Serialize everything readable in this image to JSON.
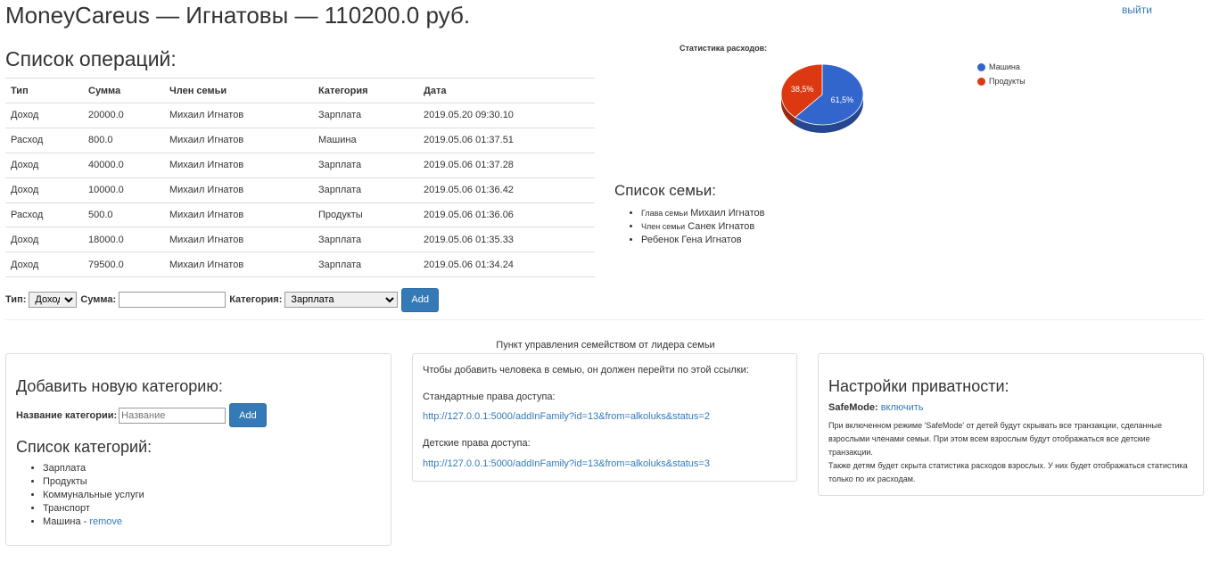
{
  "header": {
    "title": "MoneyCareus — Игнатовы — 110200.0 руб.",
    "logout_label": "выйти"
  },
  "operations": {
    "heading": "Список операций:",
    "columns": [
      "Тип",
      "Сумма",
      "Член семьи",
      "Категория",
      "Дата"
    ],
    "rows": [
      [
        "Доход",
        "20000.0",
        "Михаил Игнатов",
        "Зарплата",
        "2019.05.20 09:30.10"
      ],
      [
        "Расход",
        "800.0",
        "Михаил Игнатов",
        "Машина",
        "2019.05.06 01:37.51"
      ],
      [
        "Доход",
        "40000.0",
        "Михаил Игнатов",
        "Зарплата",
        "2019.05.06 01:37.28"
      ],
      [
        "Доход",
        "10000.0",
        "Михаил Игнатов",
        "Зарплата",
        "2019.05.06 01:36.42"
      ],
      [
        "Расход",
        "500.0",
        "Михаил Игнатов",
        "Продукты",
        "2019.05.06 01:36.06"
      ],
      [
        "Доход",
        "18000.0",
        "Михаил Игнатов",
        "Зарплата",
        "2019.05.06 01:35.33"
      ],
      [
        "Доход",
        "79500.0",
        "Михаил Игнатов",
        "Зарплата",
        "2019.05.06 01:34.24"
      ]
    ]
  },
  "add_operation": {
    "type_label": "Тип:",
    "type_value": "Доход",
    "sum_label": "Сумма:",
    "sum_value": "",
    "category_label": "Категория:",
    "category_value": "Зарплата",
    "submit_label": "Add"
  },
  "chart_data": {
    "type": "pie",
    "title": "Статистика расходов:",
    "categories": [
      "Машина",
      "Продукты"
    ],
    "values": [
      61.5,
      38.5
    ],
    "labels": [
      "61,5%",
      "38,5%"
    ],
    "colors": [
      "#3366cc",
      "#dc3912"
    ],
    "legend_position": "right"
  },
  "family": {
    "heading": "Список семьи:",
    "members": [
      {
        "role": "Глава семьи",
        "name": "Михаил Игнатов"
      },
      {
        "role": "Член семьи",
        "name": "Санек Игнатов"
      },
      {
        "role": "Ребенок",
        "name": "Гена Игнатов"
      }
    ]
  },
  "management": {
    "title": "Пункт управления семейством от лидера семьи"
  },
  "categories_panel": {
    "add_heading": "Добавить новую категорию:",
    "name_label": "Название категории:",
    "name_placeholder": "Название",
    "submit_label": "Add",
    "list_heading": "Список категорий:",
    "items": [
      "Зарплата",
      "Продукты",
      "Коммунальные услуги",
      "Транспорт",
      "Машина - "
    ],
    "remove_label": "remove"
  },
  "invite_panel": {
    "intro": "Чтобы добавить человека в семью, он должен перейти по этой ссылки:",
    "standard_label": "Стандартные права доступа:",
    "standard_link": "http://127.0.0.1:5000/addInFamily?id=13&from=alkoluks&status=2",
    "child_label": "Детские права доступа:",
    "child_link": "http://127.0.0.1:5000/addInFamily?id=13&from=alkoluks&status=3"
  },
  "privacy_panel": {
    "heading": "Настройки приватности:",
    "safemode_label": "SafeMode:",
    "safemode_link": "включить",
    "desc_1": "При включенном режиме 'SafeMode' от детей будут скрывать все транзакции, сделанные взрослыми членами семьи. При этом всем взрослым будут отображаться все детские транзакции.",
    "desc_2": "Также детям будет скрыта статистика расходов взрослых. У них будет отображаться статистика только по их расходам."
  }
}
